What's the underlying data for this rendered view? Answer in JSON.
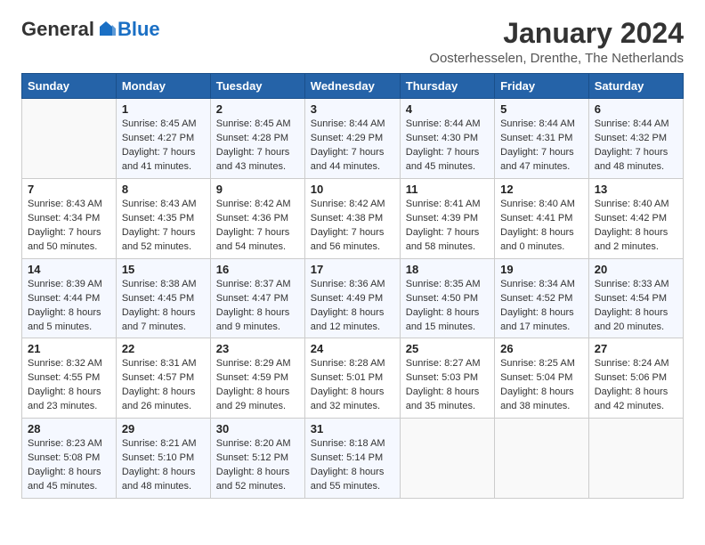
{
  "logo": {
    "general": "General",
    "blue": "Blue"
  },
  "title": "January 2024",
  "location": "Oosterhesselen, Drenthe, The Netherlands",
  "weekdays": [
    "Sunday",
    "Monday",
    "Tuesday",
    "Wednesday",
    "Thursday",
    "Friday",
    "Saturday"
  ],
  "weeks": [
    [
      {
        "day": "",
        "sunrise": "",
        "sunset": "",
        "daylight": ""
      },
      {
        "day": "1",
        "sunrise": "Sunrise: 8:45 AM",
        "sunset": "Sunset: 4:27 PM",
        "daylight": "Daylight: 7 hours and 41 minutes."
      },
      {
        "day": "2",
        "sunrise": "Sunrise: 8:45 AM",
        "sunset": "Sunset: 4:28 PM",
        "daylight": "Daylight: 7 hours and 43 minutes."
      },
      {
        "day": "3",
        "sunrise": "Sunrise: 8:44 AM",
        "sunset": "Sunset: 4:29 PM",
        "daylight": "Daylight: 7 hours and 44 minutes."
      },
      {
        "day": "4",
        "sunrise": "Sunrise: 8:44 AM",
        "sunset": "Sunset: 4:30 PM",
        "daylight": "Daylight: 7 hours and 45 minutes."
      },
      {
        "day": "5",
        "sunrise": "Sunrise: 8:44 AM",
        "sunset": "Sunset: 4:31 PM",
        "daylight": "Daylight: 7 hours and 47 minutes."
      },
      {
        "day": "6",
        "sunrise": "Sunrise: 8:44 AM",
        "sunset": "Sunset: 4:32 PM",
        "daylight": "Daylight: 7 hours and 48 minutes."
      }
    ],
    [
      {
        "day": "7",
        "sunrise": "Sunrise: 8:43 AM",
        "sunset": "Sunset: 4:34 PM",
        "daylight": "Daylight: 7 hours and 50 minutes."
      },
      {
        "day": "8",
        "sunrise": "Sunrise: 8:43 AM",
        "sunset": "Sunset: 4:35 PM",
        "daylight": "Daylight: 7 hours and 52 minutes."
      },
      {
        "day": "9",
        "sunrise": "Sunrise: 8:42 AM",
        "sunset": "Sunset: 4:36 PM",
        "daylight": "Daylight: 7 hours and 54 minutes."
      },
      {
        "day": "10",
        "sunrise": "Sunrise: 8:42 AM",
        "sunset": "Sunset: 4:38 PM",
        "daylight": "Daylight: 7 hours and 56 minutes."
      },
      {
        "day": "11",
        "sunrise": "Sunrise: 8:41 AM",
        "sunset": "Sunset: 4:39 PM",
        "daylight": "Daylight: 7 hours and 58 minutes."
      },
      {
        "day": "12",
        "sunrise": "Sunrise: 8:40 AM",
        "sunset": "Sunset: 4:41 PM",
        "daylight": "Daylight: 8 hours and 0 minutes."
      },
      {
        "day": "13",
        "sunrise": "Sunrise: 8:40 AM",
        "sunset": "Sunset: 4:42 PM",
        "daylight": "Daylight: 8 hours and 2 minutes."
      }
    ],
    [
      {
        "day": "14",
        "sunrise": "Sunrise: 8:39 AM",
        "sunset": "Sunset: 4:44 PM",
        "daylight": "Daylight: 8 hours and 5 minutes."
      },
      {
        "day": "15",
        "sunrise": "Sunrise: 8:38 AM",
        "sunset": "Sunset: 4:45 PM",
        "daylight": "Daylight: 8 hours and 7 minutes."
      },
      {
        "day": "16",
        "sunrise": "Sunrise: 8:37 AM",
        "sunset": "Sunset: 4:47 PM",
        "daylight": "Daylight: 8 hours and 9 minutes."
      },
      {
        "day": "17",
        "sunrise": "Sunrise: 8:36 AM",
        "sunset": "Sunset: 4:49 PM",
        "daylight": "Daylight: 8 hours and 12 minutes."
      },
      {
        "day": "18",
        "sunrise": "Sunrise: 8:35 AM",
        "sunset": "Sunset: 4:50 PM",
        "daylight": "Daylight: 8 hours and 15 minutes."
      },
      {
        "day": "19",
        "sunrise": "Sunrise: 8:34 AM",
        "sunset": "Sunset: 4:52 PM",
        "daylight": "Daylight: 8 hours and 17 minutes."
      },
      {
        "day": "20",
        "sunrise": "Sunrise: 8:33 AM",
        "sunset": "Sunset: 4:54 PM",
        "daylight": "Daylight: 8 hours and 20 minutes."
      }
    ],
    [
      {
        "day": "21",
        "sunrise": "Sunrise: 8:32 AM",
        "sunset": "Sunset: 4:55 PM",
        "daylight": "Daylight: 8 hours and 23 minutes."
      },
      {
        "day": "22",
        "sunrise": "Sunrise: 8:31 AM",
        "sunset": "Sunset: 4:57 PM",
        "daylight": "Daylight: 8 hours and 26 minutes."
      },
      {
        "day": "23",
        "sunrise": "Sunrise: 8:29 AM",
        "sunset": "Sunset: 4:59 PM",
        "daylight": "Daylight: 8 hours and 29 minutes."
      },
      {
        "day": "24",
        "sunrise": "Sunrise: 8:28 AM",
        "sunset": "Sunset: 5:01 PM",
        "daylight": "Daylight: 8 hours and 32 minutes."
      },
      {
        "day": "25",
        "sunrise": "Sunrise: 8:27 AM",
        "sunset": "Sunset: 5:03 PM",
        "daylight": "Daylight: 8 hours and 35 minutes."
      },
      {
        "day": "26",
        "sunrise": "Sunrise: 8:25 AM",
        "sunset": "Sunset: 5:04 PM",
        "daylight": "Daylight: 8 hours and 38 minutes."
      },
      {
        "day": "27",
        "sunrise": "Sunrise: 8:24 AM",
        "sunset": "Sunset: 5:06 PM",
        "daylight": "Daylight: 8 hours and 42 minutes."
      }
    ],
    [
      {
        "day": "28",
        "sunrise": "Sunrise: 8:23 AM",
        "sunset": "Sunset: 5:08 PM",
        "daylight": "Daylight: 8 hours and 45 minutes."
      },
      {
        "day": "29",
        "sunrise": "Sunrise: 8:21 AM",
        "sunset": "Sunset: 5:10 PM",
        "daylight": "Daylight: 8 hours and 48 minutes."
      },
      {
        "day": "30",
        "sunrise": "Sunrise: 8:20 AM",
        "sunset": "Sunset: 5:12 PM",
        "daylight": "Daylight: 8 hours and 52 minutes."
      },
      {
        "day": "31",
        "sunrise": "Sunrise: 8:18 AM",
        "sunset": "Sunset: 5:14 PM",
        "daylight": "Daylight: 8 hours and 55 minutes."
      },
      {
        "day": "",
        "sunrise": "",
        "sunset": "",
        "daylight": ""
      },
      {
        "day": "",
        "sunrise": "",
        "sunset": "",
        "daylight": ""
      },
      {
        "day": "",
        "sunrise": "",
        "sunset": "",
        "daylight": ""
      }
    ]
  ]
}
